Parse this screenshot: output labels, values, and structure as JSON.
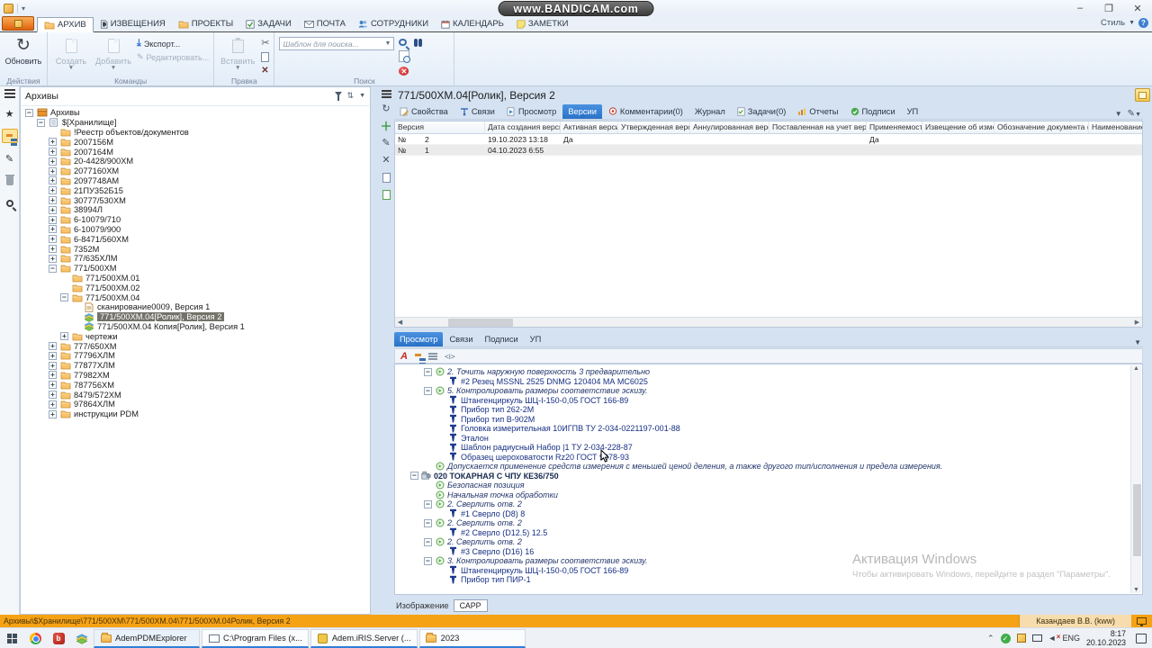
{
  "window": {
    "watermark": "www.BANDICAM.com",
    "style_menu": "Стиль",
    "window_buttons": [
      "минимизировать",
      "развернуть",
      "закрыть"
    ]
  },
  "ribbon": {
    "tabs": [
      {
        "label": "АРХИВ",
        "icon": "folder",
        "active": true
      },
      {
        "label": "ИЗВЕЩЕНИЯ",
        "icon": "notice"
      },
      {
        "label": "ПРОЕКТЫ",
        "icon": "folder"
      },
      {
        "label": "ЗАДАЧИ",
        "icon": "taskcheck"
      },
      {
        "label": "ПОЧТА",
        "icon": "mail"
      },
      {
        "label": "СОТРУДНИКИ",
        "icon": "people"
      },
      {
        "label": "КАЛЕНДАРЬ",
        "icon": "calendar"
      },
      {
        "label": "ЗАМЕТКИ",
        "icon": "notes"
      }
    ],
    "groups": {
      "actions": {
        "label": "Действия",
        "refresh": "Обновить"
      },
      "commands": {
        "label": "Команды",
        "create": "Создать",
        "add": "Добавить",
        "export": "Экспорт...",
        "edit": "Редактировать..."
      },
      "edit": {
        "label": "Правка",
        "paste": "Вставить"
      },
      "search": {
        "label": "Поиск",
        "placeholder": "Шаблон для поиска..."
      }
    }
  },
  "archive_panel": {
    "title": "Архивы",
    "items": [
      {
        "lvl": 0,
        "exp": "-",
        "icon": "archive",
        "text": "Архивы"
      },
      {
        "lvl": 1,
        "exp": "-",
        "icon": "db",
        "text": "$[Хранилище]"
      },
      {
        "lvl": 2,
        "icon": "folder",
        "text": "!Реестр объектов/документов"
      },
      {
        "lvl": 2,
        "exp": "+",
        "icon": "folder",
        "text": "2007156М"
      },
      {
        "lvl": 2,
        "exp": "+",
        "icon": "folder",
        "text": "2007164М"
      },
      {
        "lvl": 2,
        "exp": "+",
        "icon": "folder",
        "text": "20-4428/900ХМ"
      },
      {
        "lvl": 2,
        "exp": "+",
        "icon": "folder",
        "text": "2077160ХМ"
      },
      {
        "lvl": 2,
        "exp": "+",
        "icon": "folder",
        "text": "2097748АМ"
      },
      {
        "lvl": 2,
        "exp": "+",
        "icon": "folder",
        "text": "21ПУ352Б15"
      },
      {
        "lvl": 2,
        "exp": "+",
        "icon": "folder",
        "text": "30777/530ХМ"
      },
      {
        "lvl": 2,
        "exp": "+",
        "icon": "folder",
        "text": "38994Л"
      },
      {
        "lvl": 2,
        "exp": "+",
        "icon": "folder",
        "text": "6-10079/710"
      },
      {
        "lvl": 2,
        "exp": "+",
        "icon": "folder",
        "text": "6-10079/900"
      },
      {
        "lvl": 2,
        "exp": "+",
        "icon": "folder",
        "text": "6-8471/560ХМ"
      },
      {
        "lvl": 2,
        "exp": "+",
        "icon": "folder",
        "text": "7352М"
      },
      {
        "lvl": 2,
        "exp": "+",
        "icon": "folder",
        "text": "77/635ХЛМ"
      },
      {
        "lvl": 2,
        "exp": "-",
        "icon": "folder",
        "text": "771/500ХМ"
      },
      {
        "lvl": 3,
        "icon": "folder",
        "text": "771/500ХМ.01"
      },
      {
        "lvl": 3,
        "icon": "folder",
        "text": "771/500ХМ.02"
      },
      {
        "lvl": 3,
        "exp": "-",
        "icon": "folder",
        "text": "771/500ХМ.04"
      },
      {
        "lvl": 4,
        "icon": "scan",
        "text": "сканирование0009, Версия 1"
      },
      {
        "lvl": 4,
        "icon": "layers",
        "text": "771/500ХМ.04[Ролик], Версия 2",
        "sel": true
      },
      {
        "lvl": 4,
        "icon": "layers",
        "text": "771/500ХМ.04 Копия[Ролик], Версия 1"
      },
      {
        "lvl": 3,
        "exp": "+",
        "icon": "folder",
        "text": "чертежи"
      },
      {
        "lvl": 2,
        "exp": "+",
        "icon": "folder",
        "text": "777/650ХМ"
      },
      {
        "lvl": 2,
        "exp": "+",
        "icon": "folder",
        "text": "77796ХЛМ"
      },
      {
        "lvl": 2,
        "exp": "+",
        "icon": "folder",
        "text": "77877ХЛМ"
      },
      {
        "lvl": 2,
        "exp": "+",
        "icon": "folder",
        "text": "77982ХМ"
      },
      {
        "lvl": 2,
        "exp": "+",
        "icon": "folder",
        "text": "787756ХМ"
      },
      {
        "lvl": 2,
        "exp": "+",
        "icon": "folder",
        "text": "8479/572ХМ"
      },
      {
        "lvl": 2,
        "exp": "+",
        "icon": "folder",
        "text": "97864ХЛМ"
      },
      {
        "lvl": 2,
        "exp": "+",
        "icon": "folder",
        "text": "инструкции PDM"
      }
    ]
  },
  "document": {
    "title": "771/500ХМ.04[Ролик], Версия 2",
    "tabs": [
      {
        "label": "Свойства",
        "icon": "props"
      },
      {
        "label": "Связи",
        "icon": "links"
      },
      {
        "label": "Просмотр",
        "icon": "view"
      },
      {
        "label": "Версии",
        "active": true
      },
      {
        "label": "Комментарии(0)",
        "icon": "comment"
      },
      {
        "label": "Журнал"
      },
      {
        "label": "Задачи(0)",
        "icon": "task"
      },
      {
        "label": "Отчеты",
        "icon": "report"
      },
      {
        "label": "Подписи",
        "icon": "sign"
      },
      {
        "label": "УП"
      }
    ],
    "versions": {
      "columns": [
        "Версия",
        "Дата создания версии",
        "Активная версия",
        "Утвержденная версия",
        "Аннулированная версия",
        "Поставленная на учет версия",
        "Применяемость",
        "Извещение об изменении",
        "Обозначение документа (ТП)",
        "Наименование д"
      ],
      "rows": [
        [
          "2",
          "19.10.2023 13:18",
          "Да",
          "",
          "",
          "",
          "Да",
          "",
          "",
          ""
        ],
        [
          "1",
          "04.10.2023 6:55",
          "",
          "",
          "",
          "",
          "",
          "",
          "",
          ""
        ]
      ]
    }
  },
  "preview": {
    "tabs": [
      {
        "label": "Просмотр",
        "active": true
      },
      {
        "label": "Связи"
      },
      {
        "label": "Подписи"
      },
      {
        "label": "УП"
      }
    ],
    "itag": "<i>",
    "image_label": "Изображение",
    "image_value": "CAPP",
    "process_tree": [
      {
        "lvl": 1,
        "exp": "-",
        "icon": "op",
        "cls": "op",
        "text": "2.  Точить наружную поверхность 3 предварительно"
      },
      {
        "lvl": 2,
        "icon": "tool",
        "cls": "tool",
        "text": "#2 Резец MSSNL 2525    DNMG 120404 МА МС6025"
      },
      {
        "lvl": 1,
        "exp": "-",
        "icon": "op",
        "cls": "op",
        "text": "5.  Контролировать размеры соответствие эскизу."
      },
      {
        "lvl": 2,
        "icon": "tool",
        "cls": "tool",
        "text": "Штангенциркуль ШЦ-I-150-0,05 ГОСТ 166-89"
      },
      {
        "lvl": 2,
        "icon": "tool",
        "cls": "tool",
        "text": "Прибор  тип 262-2М"
      },
      {
        "lvl": 2,
        "icon": "tool",
        "cls": "tool",
        "text": "Прибор  тип В-902М"
      },
      {
        "lvl": 2,
        "icon": "tool",
        "cls": "tool",
        "text": "Головка измерительная 10ИГПВ ТУ 2-034-0221197-001-88"
      },
      {
        "lvl": 2,
        "icon": "tool",
        "cls": "tool",
        "text": "Эталон"
      },
      {
        "lvl": 2,
        "icon": "tool",
        "cls": "tool",
        "text": "Шаблон радиусный Набор |1 ТУ 2-034-228-87"
      },
      {
        "lvl": 2,
        "icon": "tool",
        "cls": "tool",
        "text": "Образец шероховатости Rz20 ГОСТ 9378-93"
      },
      {
        "lvl": 1,
        "icon": "op",
        "cls": "note",
        "text": "Допускается применение средств измерения с меньшей ценой деления, а также другого тип/исполнения и предела измерения."
      },
      {
        "lvl": 0,
        "exp": "-",
        "icon": "machine",
        "cls": "machine",
        "text": "020  ТОКАРНАЯ С ЧПУ КЕ36/750"
      },
      {
        "lvl": 1,
        "icon": "op",
        "cls": "op",
        "text": "Безопасная позиция"
      },
      {
        "lvl": 1,
        "icon": "op",
        "cls": "op",
        "text": "Начальная точка обработки"
      },
      {
        "lvl": 1,
        "exp": "-",
        "icon": "op",
        "cls": "op",
        "text": "2.  Сверлить отв. 2"
      },
      {
        "lvl": 2,
        "icon": "tool",
        "cls": "tool",
        "text": "#1 Сверло (D8)  8"
      },
      {
        "lvl": 1,
        "exp": "-",
        "icon": "op",
        "cls": "op",
        "text": "2.  Сверлить отв. 2"
      },
      {
        "lvl": 2,
        "icon": "tool",
        "cls": "tool",
        "text": "#2 Сверло (D12.5)  12.5"
      },
      {
        "lvl": 1,
        "exp": "-",
        "icon": "op",
        "cls": "op",
        "text": "2.  Сверлить отв. 2"
      },
      {
        "lvl": 2,
        "icon": "tool",
        "cls": "tool",
        "text": "#3 Сверло (D16)  16"
      },
      {
        "lvl": 1,
        "exp": "-",
        "icon": "op",
        "cls": "op",
        "text": "3.  Контролировать размеры соответствие эскизу."
      },
      {
        "lvl": 2,
        "icon": "tool",
        "cls": "tool",
        "text": "Штангенциркуль ШЦ-I-150-0,05 ГОСТ 166-89"
      },
      {
        "lvl": 2,
        "icon": "tool",
        "cls": "tool",
        "text": "Прибор  тип ПИР-1"
      }
    ]
  },
  "activation": {
    "line1": "Активация Windows",
    "line2": "Чтобы активировать Windows, перейдите в раздел \"Параметры\"."
  },
  "statusbar": {
    "path": "Архивы\\$Хранилище\\771/500ХМ\\771/500ХМ.04\\771/500ХМ.04Ролик, Версия 2",
    "user": "Казандаев В.В. (kww)"
  },
  "taskbar": {
    "buttons": [
      {
        "label": "AdemPDMExplorer",
        "icon": "fold",
        "active": true
      },
      {
        "label": "C:\\Program Files (x...",
        "icon": "winfold"
      },
      {
        "label": "Adem.iRIS.Server (...",
        "icon": "gear"
      },
      {
        "label": "2023",
        "icon": "fold"
      }
    ],
    "tray": {
      "lang": "ENG",
      "time": "8:17",
      "date": "20.10.2023"
    }
  }
}
